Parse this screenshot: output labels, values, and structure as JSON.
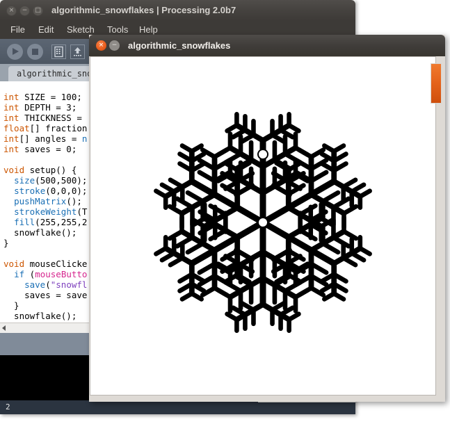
{
  "pde_window": {
    "title": "algorithmic_snowflakes | Processing 2.0b7",
    "controls": {
      "close": "×",
      "minimize": "−",
      "maximize": "□"
    },
    "menu": [
      {
        "label": "File"
      },
      {
        "label": "Edit"
      },
      {
        "label": "Sketch"
      },
      {
        "label": "Tools"
      },
      {
        "label": "Help"
      }
    ],
    "toolbar": [
      {
        "name": "run-button",
        "icon": "play-icon"
      },
      {
        "name": "stop-button",
        "icon": "stop-icon"
      },
      {
        "name": "new-button",
        "icon": "new-document-icon"
      },
      {
        "name": "open-button",
        "icon": "open-upload-icon"
      }
    ],
    "tab_label": "algorithmic_sno",
    "status_line_number": "2"
  },
  "code": {
    "lines": [
      [
        {
          "t": "int",
          "c": "kw"
        },
        {
          "t": " SIZE = 100;",
          "c": "plain"
        }
      ],
      [
        {
          "t": "int",
          "c": "kw"
        },
        {
          "t": " DEPTH = 3;",
          "c": "plain"
        }
      ],
      [
        {
          "t": "int",
          "c": "kw"
        },
        {
          "t": " THICKNESS = ",
          "c": "plain"
        }
      ],
      [
        {
          "t": "float",
          "c": "kw"
        },
        {
          "t": "[] fraction",
          "c": "plain"
        }
      ],
      [
        {
          "t": "int",
          "c": "kw"
        },
        {
          "t": "[] angles = ",
          "c": "plain"
        },
        {
          "t": "n",
          "c": "fn"
        }
      ],
      [
        {
          "t": "int",
          "c": "kw"
        },
        {
          "t": " saves = 0;",
          "c": "plain"
        }
      ],
      [],
      [
        {
          "t": "void",
          "c": "kw"
        },
        {
          "t": " setup() {",
          "c": "plain"
        }
      ],
      [
        {
          "t": "  ",
          "c": "plain"
        },
        {
          "t": "size",
          "c": "fn"
        },
        {
          "t": "(500,500);",
          "c": "plain"
        }
      ],
      [
        {
          "t": "  ",
          "c": "plain"
        },
        {
          "t": "stroke",
          "c": "fn"
        },
        {
          "t": "(0,0,0);",
          "c": "plain"
        }
      ],
      [
        {
          "t": "  ",
          "c": "plain"
        },
        {
          "t": "pushMatrix",
          "c": "fn"
        },
        {
          "t": "();",
          "c": "plain"
        }
      ],
      [
        {
          "t": "  ",
          "c": "plain"
        },
        {
          "t": "strokeWeight",
          "c": "fn"
        },
        {
          "t": "(T",
          "c": "plain"
        }
      ],
      [
        {
          "t": "  ",
          "c": "plain"
        },
        {
          "t": "fill",
          "c": "fn"
        },
        {
          "t": "(255,255,2",
          "c": "plain"
        }
      ],
      [
        {
          "t": "  snowflake();",
          "c": "plain"
        }
      ],
      [
        {
          "t": "}",
          "c": "plain"
        }
      ],
      [],
      [
        {
          "t": "void",
          "c": "kw"
        },
        {
          "t": " mouseClicke",
          "c": "plain"
        }
      ],
      [
        {
          "t": "  ",
          "c": "plain"
        },
        {
          "t": "if",
          "c": "fn"
        },
        {
          "t": " (",
          "c": "plain"
        },
        {
          "t": "mouseButto",
          "c": "var"
        }
      ],
      [
        {
          "t": "    ",
          "c": "plain"
        },
        {
          "t": "save",
          "c": "fn"
        },
        {
          "t": "(",
          "c": "plain"
        },
        {
          "t": "\"snowfl",
          "c": "str"
        }
      ],
      [
        {
          "t": "    saves = save",
          "c": "plain"
        }
      ],
      [
        {
          "t": "  }",
          "c": "plain"
        }
      ],
      [
        {
          "t": "  snowflake();",
          "c": "plain"
        }
      ],
      [
        {
          "t": "}",
          "c": "plain"
        }
      ]
    ]
  },
  "sketch_window": {
    "title": "algorithmic_snowflakes",
    "controls": {
      "close": "×",
      "minimize": "−"
    },
    "canvas": {
      "background": "#ffffff",
      "shape_color": "#000000",
      "shape_name": "snowflake-fractal",
      "size": "500,500",
      "depth": 3,
      "arms": 6
    }
  },
  "colors": {
    "keyword": "#cc5500",
    "function": "#1a6fb5",
    "variable": "#d6258e",
    "string": "#7d3fbd",
    "accent_orange": "#e4621a",
    "titlebar": "#3d3a37",
    "toolbar": "#4d5763",
    "tabstrip": "#9aa3ad",
    "message_area": "#808b99",
    "console": "#000000",
    "statusbar": "#2b3440"
  }
}
